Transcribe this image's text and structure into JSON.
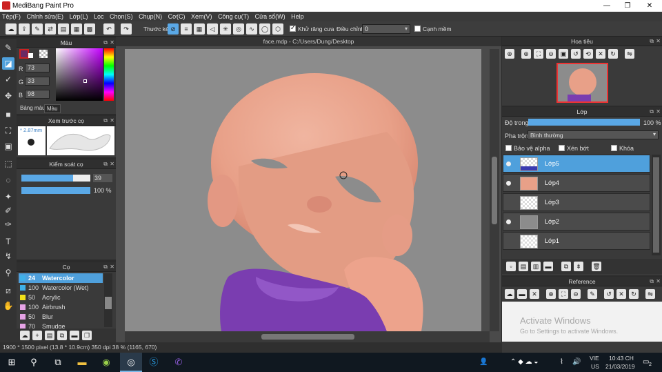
{
  "window": {
    "title": "MediBang Paint Pro",
    "minimize": "—",
    "restore": "❐",
    "close": "✕"
  },
  "menu": [
    "Tệp(F)",
    "Chỉnh sửa(E)",
    "Lớp(L)",
    "Lọc",
    "Chọn(S)",
    "Chụp(N)",
    "Cơ(C)",
    "Xem(V)",
    "Công cụ(T)",
    "Cửa sổ(W)",
    "Help"
  ],
  "toolbar": {
    "ruler_label": "Thước kẻ",
    "antialias_label": "Khử răng cưa",
    "antialias_checked": true,
    "adjust_label": "Điều chỉnh",
    "adjust_value": "0",
    "smooth_label": "Cạnh mềm",
    "smooth_checked": false
  },
  "color_panel": {
    "title": "Màu",
    "r_label": "R",
    "r_value": "73",
    "g_label": "G",
    "g_value": "33",
    "b_label": "B",
    "b_value": "98",
    "tab_palette": "Bảng màu",
    "tab_color": "Màu",
    "primary_color": "#6a2a64"
  },
  "brush_preview": {
    "title": "Xem trước cọ",
    "size": "* 2.87mm"
  },
  "brush_control": {
    "title": "Kiểm soát cọ",
    "size_value": "39",
    "size_fraction": 0.75,
    "opacity_value": "100 %",
    "opacity_fraction": 1.0
  },
  "brush_panel": {
    "title": "Cọ",
    "items": [
      {
        "size": "24",
        "name": "Watercolor",
        "color": "#3fb0e8",
        "selected": true
      },
      {
        "size": "100",
        "name": "Watercolor (Wet)",
        "color": "#3fb0e8",
        "selected": false
      },
      {
        "size": "50",
        "name": "Acrylic",
        "color": "#f2e21a",
        "selected": false
      },
      {
        "size": "100",
        "name": "Airbrush",
        "color": "#e6a3e6",
        "selected": false
      },
      {
        "size": "50",
        "name": "Blur",
        "color": "#e6a3e6",
        "selected": false
      },
      {
        "size": "70",
        "name": "Smudge",
        "color": "#e6a3e6",
        "selected": false
      }
    ]
  },
  "document": {
    "tab": "face.mdp - C:/Users/Dung/Desktop"
  },
  "status": {
    "text": "1900 * 1500 pixel  (13.8 * 10.9cm)  350 dpi  38 %  (1165, 670)"
  },
  "navigator": {
    "title": "Hoa tiêu"
  },
  "layer_panel": {
    "title": "Lớp",
    "opacity_label": "Độ trong",
    "opacity_value": "100 %",
    "opacity_fraction": 1.0,
    "blend_label": "Pha trộn",
    "blend_value": "Bình thường",
    "protect_alpha": "Bảo vệ alpha",
    "clipping": "Xén bớt",
    "lock": "Khóa",
    "layers": [
      {
        "name": "Lớp5",
        "selected": true,
        "visible": true
      },
      {
        "name": "Lớp4",
        "selected": false,
        "visible": true
      },
      {
        "name": "Lớp3",
        "selected": false,
        "visible": false
      },
      {
        "name": "Lớp2",
        "selected": false,
        "visible": true
      },
      {
        "name": "Lớp1",
        "selected": false,
        "visible": false
      }
    ]
  },
  "reference": {
    "title": "Reference"
  },
  "watermark": {
    "line1": "Activate Windows",
    "line2": "Go to Settings to activate Windows."
  },
  "taskbar": {
    "lang1": "VIE",
    "lang2": "US",
    "time": "10:43 CH",
    "date": "21/03/2019",
    "notif_count": "2"
  }
}
